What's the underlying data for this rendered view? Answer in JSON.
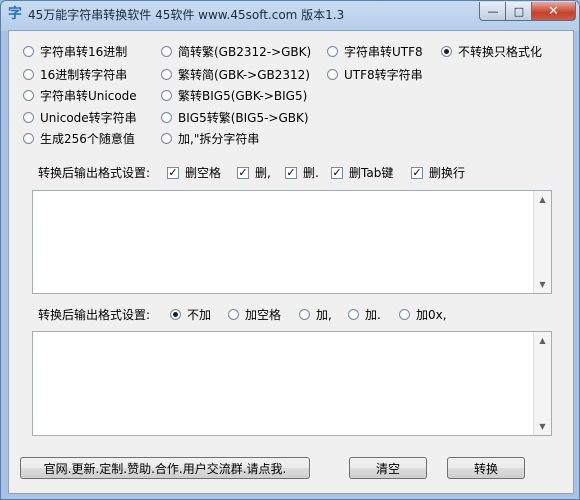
{
  "window": {
    "title": "45万能字符串转换软件 45软件 www.45soft.com 版本1.3",
    "icon_glyph": "字",
    "min_glyph": "—",
    "max_glyph": "□",
    "close_glyph": "✕"
  },
  "conversion_options": [
    {
      "label": "字符串转16进制",
      "selected": false
    },
    {
      "label": "16进制转字符串",
      "selected": false
    },
    {
      "label": "字符串转Unicode",
      "selected": false
    },
    {
      "label": "Unicode转字符串",
      "selected": false
    },
    {
      "label": "生成256个随意值",
      "selected": false
    },
    {
      "label": "简转繁(GB2312->GBK)",
      "selected": false
    },
    {
      "label": "繁转简(GBK->GB2312)",
      "selected": false
    },
    {
      "label": "繁转BIG5(GBK->BIG5)",
      "selected": false
    },
    {
      "label": "BIG5转繁(BIG5->GBK)",
      "selected": false
    },
    {
      "label": "加,\"拆分字符串",
      "selected": false
    },
    {
      "label": "字符串转UTF8",
      "selected": false
    },
    {
      "label": "UTF8转字符串",
      "selected": false
    },
    {
      "label": "不转换只格式化",
      "selected": true
    }
  ],
  "input_format": {
    "label": "转换后输出格式设置:",
    "checkboxes": [
      {
        "label": "删空格",
        "checked": true
      },
      {
        "label": "删,",
        "checked": true
      },
      {
        "label": "删.",
        "checked": true
      },
      {
        "label": "删Tab键",
        "checked": true
      },
      {
        "label": "删换行",
        "checked": true
      }
    ],
    "check_glyph": "✓",
    "text": ""
  },
  "output_format": {
    "label": "转换后输出格式设置:",
    "radios": [
      {
        "label": "不加",
        "selected": true
      },
      {
        "label": "加空格",
        "selected": false
      },
      {
        "label": "加,",
        "selected": false
      },
      {
        "label": "加.",
        "selected": false
      },
      {
        "label": "加0x,",
        "selected": false
      }
    ],
    "text": ""
  },
  "scroll_up_glyph": "▲",
  "scroll_down_glyph": "▼",
  "buttons": {
    "website": "官网.更新.定制.赞助.合作.用户交流群.请点我.",
    "clear": "清空",
    "convert": "转换"
  }
}
